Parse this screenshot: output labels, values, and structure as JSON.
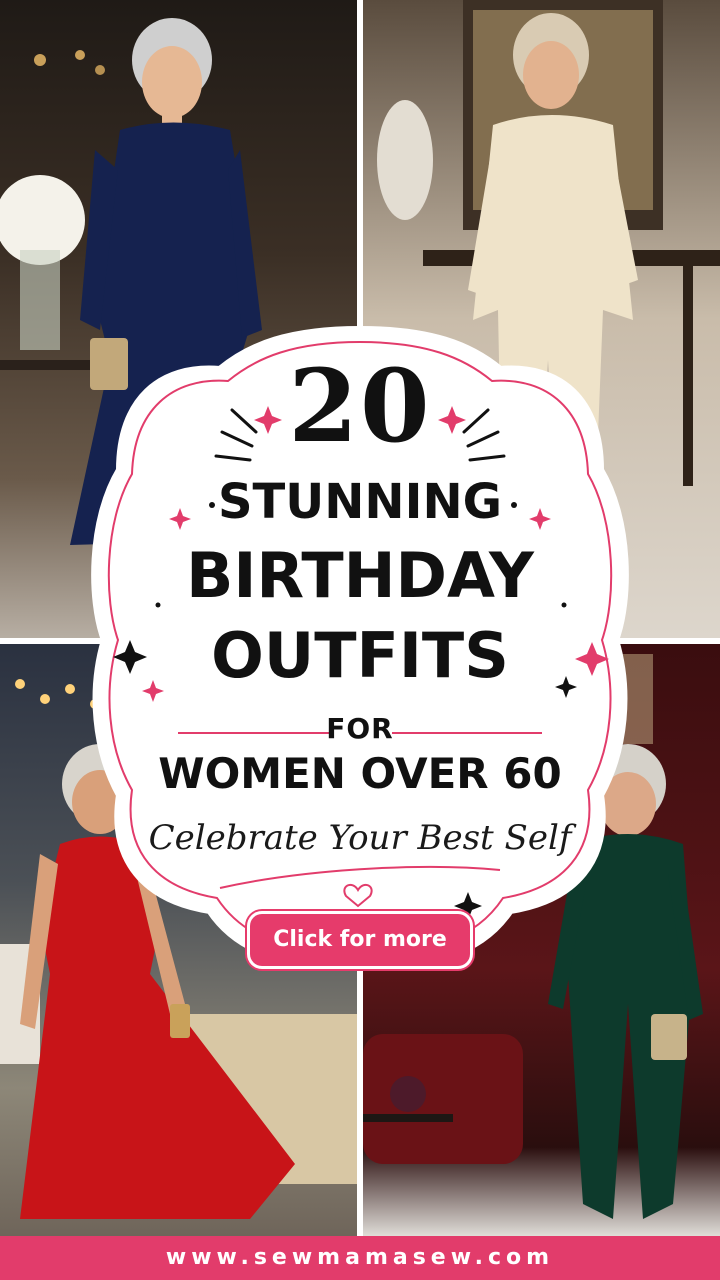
{
  "headline": {
    "number": "20",
    "line1": "STUNNING",
    "line2": "BIRTHDAY",
    "line3": "OUTFITS",
    "line4": "FOR",
    "line5": "WOMEN OVER 60",
    "tagline": "Celebrate Your Best Self"
  },
  "cta": {
    "label": "Click for more"
  },
  "footer": {
    "url": "www.sewmamasew.com"
  },
  "colors": {
    "accent": "#e23c6b",
    "text": "#111111"
  },
  "photos": [
    {
      "outfit": "navy wrap dress"
    },
    {
      "outfit": "champagne satin tunic and wide-leg pants"
    },
    {
      "outfit": "red pleated halter maxi dress"
    },
    {
      "outfit": "emerald velvet jumpsuit"
    }
  ]
}
